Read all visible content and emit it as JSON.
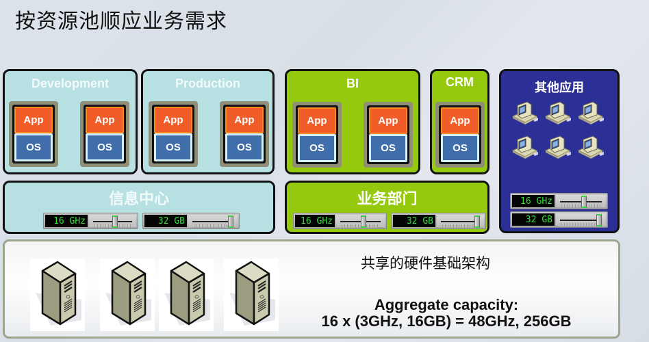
{
  "title": "按资源池顺应业务需求",
  "colors": {
    "it_pool": "#b7e0e3",
    "business_pool": "#94c90e",
    "other_pool": "#2c2f96",
    "app_layer": "#f05d28",
    "os_layer": "#3f6eaa",
    "meter_text": "#35e23a"
  },
  "groups": [
    {
      "label": "Development",
      "vms": [
        {
          "app": "App",
          "os": "OS"
        },
        {
          "app": "App",
          "os": "OS"
        }
      ]
    },
    {
      "label": "Production",
      "vms": [
        {
          "app": "App",
          "os": "OS"
        },
        {
          "app": "App",
          "os": "OS"
        }
      ]
    },
    {
      "label": "BI",
      "vms": [
        {
          "app": "App",
          "os": "OS"
        },
        {
          "app": "App",
          "os": "OS"
        }
      ]
    },
    {
      "label": "CRM",
      "vms": [
        {
          "app": "App",
          "os": "OS"
        }
      ]
    }
  ],
  "pools": [
    {
      "label": "信息中心",
      "cpu": {
        "value": "16 GHz",
        "level": 0.55
      },
      "mem": {
        "value": "32 GB",
        "level": 0.9
      }
    },
    {
      "label": "业务部门",
      "cpu": {
        "value": "16 GHz",
        "level": 0.55
      },
      "mem": {
        "value": "32 GB",
        "level": 0.9
      }
    },
    {
      "label": "其他应用",
      "cpu": {
        "value": "16 GHz",
        "level": 0.55
      },
      "mem": {
        "value": "32 GB",
        "level": 0.9
      },
      "icon_count": 6,
      "icon": "desktop-computer-icon"
    }
  ],
  "infrastructure": {
    "title": "共享的硬件基础架构",
    "capacity_label": "Aggregate capacity:",
    "capacity_formula": "16 x (3GHz, 16GB) = 48GHz, 256GB",
    "server_count": 4,
    "server_icon": "server-tower-icon"
  }
}
